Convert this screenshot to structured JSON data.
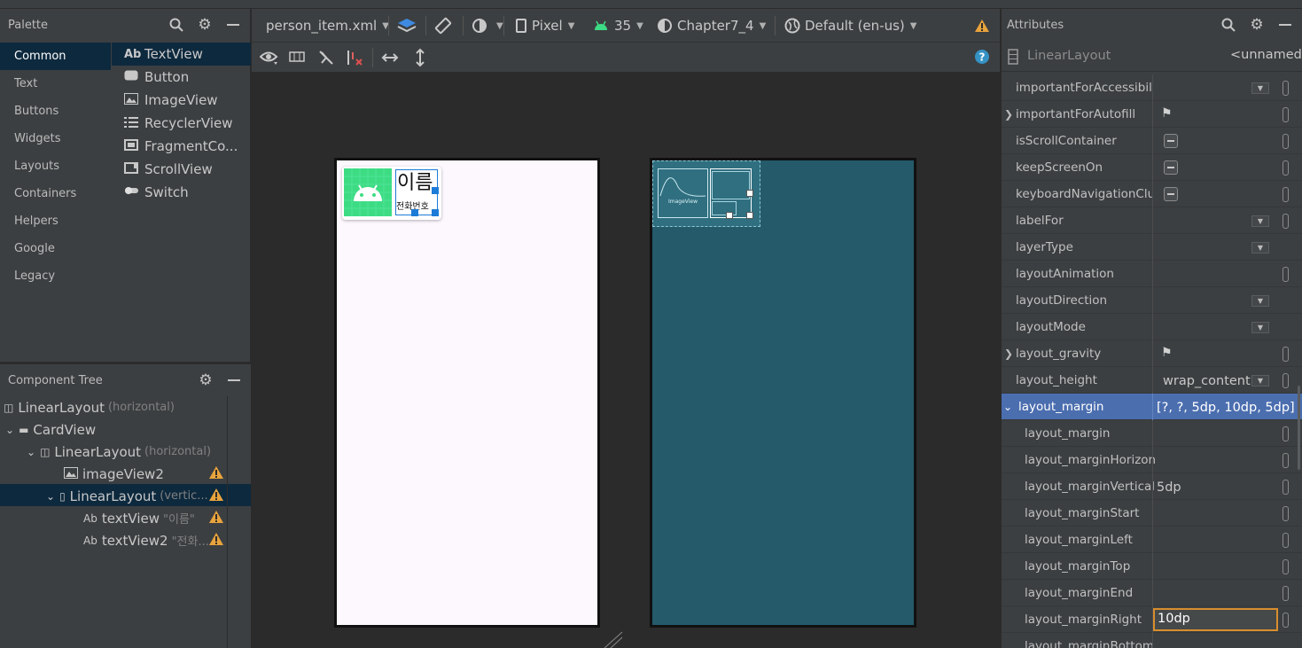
{
  "palette": {
    "title": "Palette",
    "categories": [
      "Common",
      "Text",
      "Buttons",
      "Widgets",
      "Layouts",
      "Containers",
      "Helpers",
      "Google",
      "Legacy"
    ],
    "widgets": [
      {
        "icon": "Ab",
        "label": "TextView"
      },
      {
        "icon": "button-icon",
        "label": "Button"
      },
      {
        "icon": "image-icon",
        "label": "ImageView"
      },
      {
        "icon": "list-icon",
        "label": "RecyclerView"
      },
      {
        "icon": "fragment-icon",
        "label": "FragmentCo..."
      },
      {
        "icon": "scroll-icon",
        "label": "ScrollView"
      },
      {
        "icon": "switch-icon",
        "label": "Switch"
      }
    ]
  },
  "tree": {
    "title": "Component Tree",
    "items": [
      {
        "label": "LinearLayout",
        "sub": "(horizontal)"
      },
      {
        "label": "CardView",
        "sub": ""
      },
      {
        "label": "LinearLayout",
        "sub": "(horizontal)"
      },
      {
        "label": "imageView2",
        "sub": ""
      },
      {
        "label": "LinearLayout",
        "sub": "(vertic..."
      },
      {
        "label": "textView",
        "sub": "\"이름\""
      },
      {
        "label": "textView2",
        "sub": "\"전화..."
      }
    ]
  },
  "toolbar": {
    "file": "person_item.xml",
    "device": "Pixel",
    "api": "35",
    "theme": "Chapter7_4",
    "locale": "Default (en-us)"
  },
  "preview": {
    "name_text": "이름",
    "phone_text": "전화번호",
    "blueprint_label": "ImageView"
  },
  "attributes": {
    "title": "Attributes",
    "component": "LinearLayout",
    "component_id": "<unnamed>",
    "rows": [
      {
        "name": "importantForAccessibility",
        "value": ""
      },
      {
        "name": "importantForAutofill",
        "value": ""
      },
      {
        "name": "isScrollContainer",
        "value": ""
      },
      {
        "name": "keepScreenOn",
        "value": ""
      },
      {
        "name": "keyboardNavigationClus...",
        "value": ""
      },
      {
        "name": "labelFor",
        "value": ""
      },
      {
        "name": "layerType",
        "value": ""
      },
      {
        "name": "layoutAnimation",
        "value": ""
      },
      {
        "name": "layoutDirection",
        "value": ""
      },
      {
        "name": "layoutMode",
        "value": ""
      },
      {
        "name": "layout_gravity",
        "value": ""
      },
      {
        "name": "layout_height",
        "value": "wrap_content"
      },
      {
        "name": "layout_margin",
        "value": "[?, ?, 5dp, 10dp, 5dp]"
      },
      {
        "name": "layout_margin",
        "value": ""
      },
      {
        "name": "layout_marginHorizont...",
        "value": ""
      },
      {
        "name": "layout_marginVertical",
        "value": "5dp"
      },
      {
        "name": "layout_marginStart",
        "value": ""
      },
      {
        "name": "layout_marginLeft",
        "value": ""
      },
      {
        "name": "layout_marginTop",
        "value": ""
      },
      {
        "name": "layout_marginEnd",
        "value": ""
      },
      {
        "name": "layout_marginRight",
        "value": "10dp"
      },
      {
        "name": "layout_marginBottom",
        "value": ""
      }
    ]
  },
  "colors": {
    "accent": "#4b6eaf",
    "selection": "#0d293e",
    "warning": "#e8a33d",
    "blueprint_bg": "#245a6a",
    "focus_border": "#d88e2d"
  }
}
